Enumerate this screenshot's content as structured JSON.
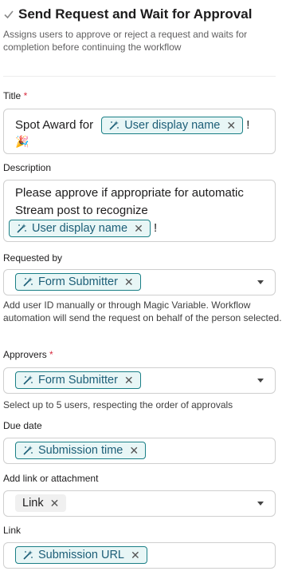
{
  "header": {
    "title": "Send Request and Wait for Approval",
    "subtitle": "Assigns users to approve or reject a request and waits for completion before continuing the workflow"
  },
  "fields": {
    "title": {
      "label": "Title",
      "required_mark": "*",
      "text_prefix": "Spot Award for",
      "chip": "User display name",
      "text_suffix": "!",
      "emoji": "🎉"
    },
    "description": {
      "label": "Description",
      "line1": "Please approve if appropriate for automatic",
      "line2": "Stream post to recognize",
      "chip": "User display name",
      "text_suffix": "!"
    },
    "requested_by": {
      "label": "Requested by",
      "chip": "Form Submitter",
      "help": "Add user ID manually or through Magic Variable. Workflow automation will send the request on behalf of the person selected."
    },
    "approvers": {
      "label": "Approvers",
      "required_mark": "*",
      "chip": "Form Submitter",
      "help": "Select up to 5 users, respecting the order of approvals"
    },
    "due_date": {
      "label": "Due date",
      "chip": "Submission time"
    },
    "link_or_attachment": {
      "label": "Add link or attachment",
      "chip": "Link"
    },
    "link": {
      "label": "Link",
      "chip": "Submission URL"
    }
  },
  "icons": {
    "check": "checkmark-icon",
    "magic": "magic-wand-icon",
    "remove": "close-icon",
    "dropdown": "chevron-down-icon"
  },
  "colors": {
    "chip_border": "#1a7f86",
    "chip_background": "#e8f6f6",
    "chip_text": "#1c5e77",
    "required": "#d72b3f"
  }
}
